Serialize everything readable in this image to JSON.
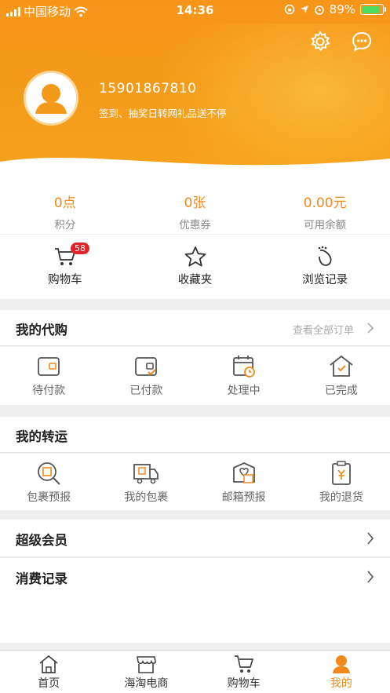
{
  "status_bar": {
    "carrier": "中国移动",
    "time": "14:36",
    "battery": "89%"
  },
  "profile": {
    "phone": "15901867810",
    "tagline": "签到、抽奖日转网礼品送不停"
  },
  "stats": [
    {
      "value": "0点",
      "label": "积分"
    },
    {
      "value": "0张",
      "label": "优惠券"
    },
    {
      "value": "0.00元",
      "label": "可用余额"
    }
  ],
  "quick_links": {
    "cart": "购物车",
    "cart_badge": "58",
    "favorites": "收藏夹",
    "history": "浏览记录"
  },
  "purchase": {
    "title": "我的代购",
    "view_all": "查看全部订单",
    "items": {
      "pending_payment": "待付款",
      "paid": "已付款",
      "processing": "处理中",
      "completed": "已完成"
    }
  },
  "forwarding": {
    "title": "我的转运",
    "items": {
      "parcel_forecast": "包裹预报",
      "my_parcels": "我的包裹",
      "mailbox_forecast": "邮箱预报",
      "my_returns": "我的退货"
    }
  },
  "rows": {
    "super_member": "超级会员",
    "spending_records": "消费记录"
  },
  "tabbar": {
    "home": "首页",
    "haitao": "海淘电商",
    "cart": "购物车",
    "mine": "我的"
  },
  "colors": {
    "accent": "#f08a1c",
    "header": "#f7951b",
    "badge": "#e0242a"
  }
}
